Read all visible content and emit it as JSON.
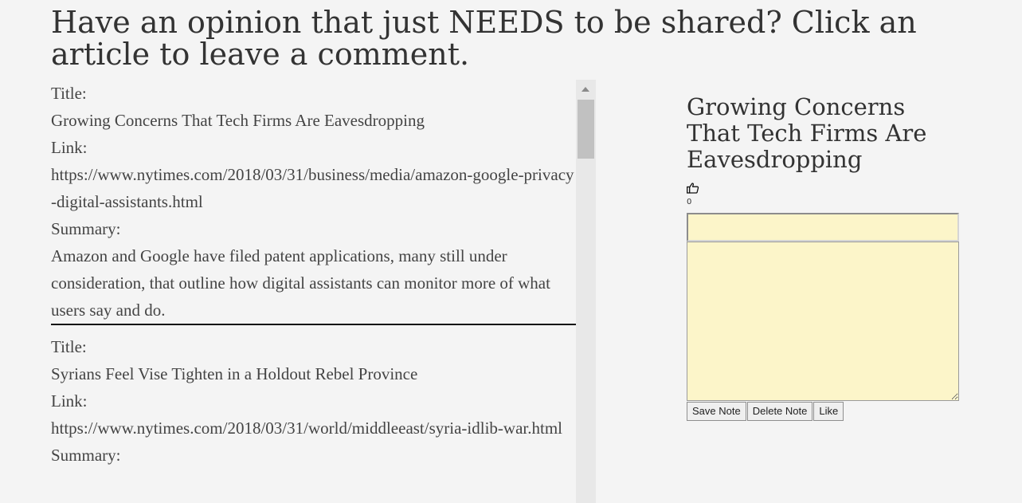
{
  "header": {
    "title": "Have an opinion that just NEEDS to be shared? Click an article to leave a comment."
  },
  "articles": [
    {
      "title_label": "Title:",
      "title": "Growing Concerns That Tech Firms Are Eavesdropping",
      "link_label": "Link:",
      "link": "https://www.nytimes.com/2018/03/31/business/media/amazon-google-privacy-digital-assistants.html",
      "summary_label": "Summary:",
      "summary": "Amazon and Google have filed patent applications, many still under consideration, that outline how digital assistants can monitor more of what users say and do."
    },
    {
      "title_label": "Title:",
      "title": "Syrians Feel Vise Tighten in a Holdout Rebel Province",
      "link_label": "Link:",
      "link": "https://www.nytimes.com/2018/03/31/world/middleeast/syria-idlib-war.html",
      "summary_label": "Summary:",
      "summary": ""
    }
  ],
  "note_panel": {
    "title": "Growing Concerns That Tech Firms Are Eavesdropping",
    "like_icon": "thumbs-up-icon",
    "like_count": "0",
    "note_title_value": "",
    "note_body_value": "",
    "save_label": "Save Note",
    "delete_label": "Delete Note",
    "like_label": "Like"
  },
  "colors": {
    "background": "#f4f4f4",
    "note_fill": "#fcf5c9",
    "text": "#333333"
  }
}
